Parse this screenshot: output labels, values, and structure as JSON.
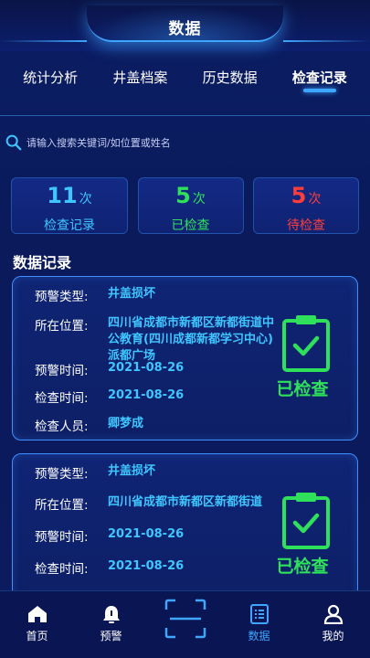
{
  "header": {
    "title": "数据"
  },
  "tabs": [
    {
      "label": "统计分析"
    },
    {
      "label": "井盖档案"
    },
    {
      "label": "历史数据"
    },
    {
      "label": "检查记录",
      "active": true
    }
  ],
  "search": {
    "placeholder": "请输入搜索关键词/如位置或姓名",
    "value": ""
  },
  "stats": [
    {
      "value": "11",
      "unit": "次",
      "label": "检查记录",
      "color": "#3fc6ff"
    },
    {
      "value": "5",
      "unit": "次",
      "label": "已检查",
      "color": "#2fe05a"
    },
    {
      "value": "5",
      "unit": "次",
      "label": "待检查",
      "color": "#ff3d3d"
    }
  ],
  "section": {
    "title": "数据记录"
  },
  "records": [
    {
      "fields": [
        {
          "label": "预警类型:",
          "value": "井盖损坏"
        },
        {
          "label": "所在位置:",
          "value": "四川省成都市新都区新都街道中公教育(四川成都新都学习中心)派都广场"
        },
        {
          "label": "预警时间:",
          "value": "2021-08-26"
        },
        {
          "label": "检查时间:",
          "value": "2021-08-26"
        },
        {
          "label": "检查人员:",
          "value": "卿梦成"
        }
      ],
      "status": "已检查"
    },
    {
      "fields": [
        {
          "label": "预警类型:",
          "value": "井盖损坏"
        },
        {
          "label": "所在位置:",
          "value": "四川省成都市新都区新都街道"
        },
        {
          "label": "预警时间:",
          "value": "2021-08-26"
        },
        {
          "label": "检查时间:",
          "value": "2021-08-26"
        }
      ],
      "status": "已检查"
    }
  ],
  "nav": [
    {
      "label": "首页",
      "icon": "home-icon"
    },
    {
      "label": "预警",
      "icon": "bell-icon"
    },
    {
      "label": "",
      "icon": "scan-icon"
    },
    {
      "label": "数据",
      "icon": "list-icon",
      "active": true
    },
    {
      "label": "我的",
      "icon": "user-icon"
    }
  ],
  "colors": {
    "accent": "#3fa6ff",
    "value": "#3fc6ff",
    "checked": "#2fe05a",
    "pending": "#ff3d3d",
    "background": "#0b1d63"
  }
}
